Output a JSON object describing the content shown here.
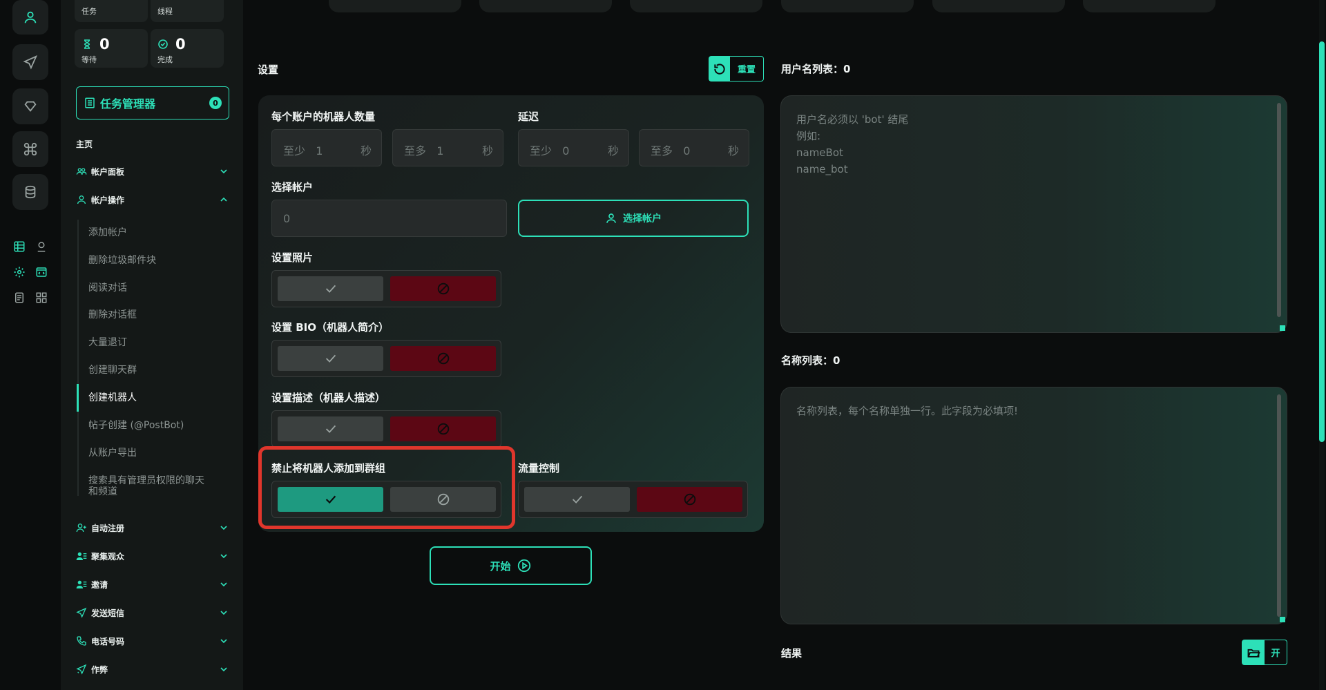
{
  "colors": {
    "accent": "#2de0b8",
    "danger": "#5c0714",
    "success": "#1e9a80",
    "highlight": "#e0362c"
  },
  "rail": {
    "icons": [
      "user-icon",
      "send-icon",
      "heart-icon",
      "command-icon",
      "database-icon"
    ],
    "small_icons": [
      "list-icon",
      "account-icon",
      "gear-icon",
      "code-icon",
      "note-icon",
      "apps-icon"
    ]
  },
  "stats": {
    "tasks_label": "任务",
    "threads_label": "线程",
    "waiting": {
      "value": "0",
      "label": "等待"
    },
    "done": {
      "value": "0",
      "label": "完成"
    }
  },
  "task_manager": {
    "label": "任务管理器",
    "badge": "0"
  },
  "sidebar": {
    "home": "主页",
    "account_panel": "帐户面板",
    "account_ops": "帐户操作",
    "sub_items": [
      "添加帐户",
      "删除垃圾邮件块",
      "阅读对话",
      "删除对话框",
      "大量退订",
      "创建聊天群",
      "创建机器人",
      "帖子创建 (@PostBot)",
      "从账户导出",
      "搜索具有管理员权限的聊天和频道"
    ],
    "groups": [
      "自动注册",
      "聚集观众",
      "邀请",
      "发送短信",
      "电话号码",
      "作弊"
    ]
  },
  "settings": {
    "title": "设置",
    "reset_label": "重置",
    "bots_per_account_label": "每个账户的机器人数量",
    "delay_label": "延迟",
    "bots_min": {
      "placeholder": "至少",
      "value": "1",
      "unit": "秒"
    },
    "bots_max": {
      "placeholder": "至多",
      "value": "1",
      "unit": "秒"
    },
    "delay_min": {
      "placeholder": "至少",
      "value": "0",
      "unit": "秒"
    },
    "delay_max": {
      "placeholder": "至多",
      "value": "0",
      "unit": "秒"
    },
    "choose_account_label": "选择帐户",
    "choose_account_value": "0",
    "choose_account_button": "选择帐户",
    "set_photo_label": "设置照片",
    "set_bio_label": "设置 BIO（机器人简介）",
    "set_desc_label": "设置描述（机器人描述）",
    "block_groups_label": "禁止将机器人添加到群组",
    "flow_control_label": "流量控制",
    "start_label": "开始"
  },
  "usernames": {
    "title": "用户名列表：0",
    "placeholder_lines": [
      "用户名必须以 'bot' 结尾",
      "例如:",
      "nameBot",
      "name_bot"
    ]
  },
  "names": {
    "title": "名称列表：0",
    "placeholder": "名称列表，每个名称单独一行。此字段为必填项!"
  },
  "result": {
    "title": "结果",
    "open_label": "开"
  }
}
